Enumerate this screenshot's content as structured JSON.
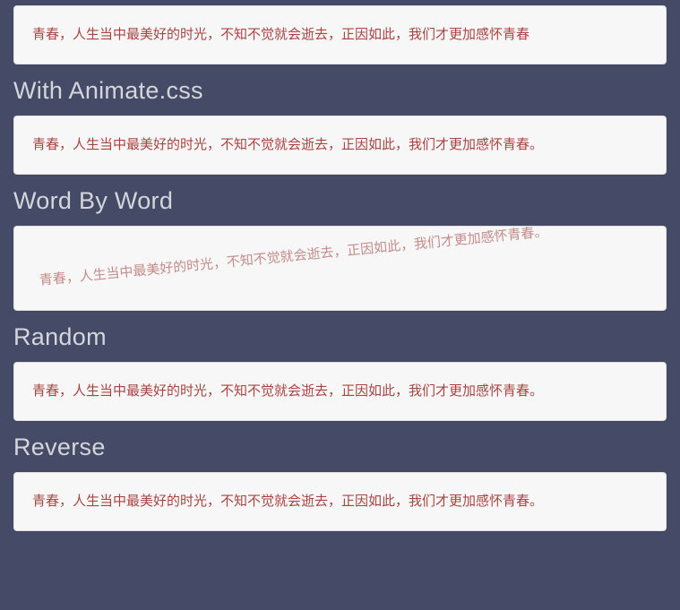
{
  "sections": {
    "first": {
      "text": "青春，人生当中最美好的时光，不知不觉就会逝去，正因如此，我们才更加感怀青春"
    },
    "animate": {
      "title": "With Animate.css",
      "text": "青春，人生当中最美好的时光，不知不觉就会逝去，正因如此，我们才更加感怀青春。"
    },
    "wordbyword": {
      "title": "Word By Word",
      "text": "青春，人生当中最美好的时光，不知不觉就会逝去，正因如此，我们才更加感怀青春。"
    },
    "random": {
      "title": "Random",
      "text": "青春，人生当中最美好的时光，不知不觉就会逝去，正因如此，我们才更加感怀青春。"
    },
    "reverse": {
      "title": "Reverse",
      "text": "青春，人生当中最美好的时光，不知不觉就会逝去，正因如此，我们才更加感怀青春。"
    }
  }
}
